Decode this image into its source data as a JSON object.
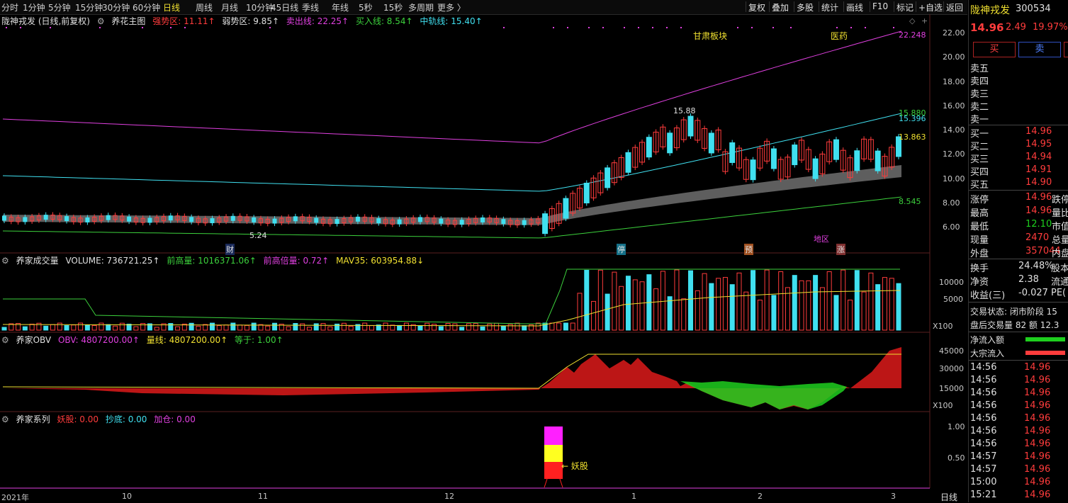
{
  "toolbar": {
    "timeframes": [
      "分时",
      "1分钟",
      "5分钟",
      "15分钟",
      "30分钟",
      "60分钟",
      "日线",
      "周线",
      "月线",
      "10分钟",
      "45日线",
      "季线",
      "年线",
      "5秒",
      "15秒",
      "多周期",
      "更多 〉"
    ],
    "active_timeframe": "日线",
    "right_buttons": [
      "复权",
      "叠加",
      "多股",
      "统计",
      "画线",
      "F10",
      "标记",
      "+自选",
      "返回"
    ]
  },
  "main_legend": {
    "title": "陇神戎发 (日线,前复权)",
    "indicator": "养花主图",
    "items": [
      {
        "label": "强势区: 11.11↑",
        "color": "#ff3c3c"
      },
      {
        "label": "弱势区: 9.85↑",
        "color": "#e0e0e0"
      },
      {
        "label": "卖出线: 22.25↑",
        "color": "#e040e0"
      },
      {
        "label": "买入线: 8.54↑",
        "color": "#3cd13c"
      },
      {
        "label": "中轨线: 15.40↑",
        "color": "#40e0f0"
      }
    ]
  },
  "main_y_ticks": [
    "22.00",
    "20.00",
    "18.00",
    "16.00",
    "14.00",
    "12.00",
    "10.00",
    "8.00",
    "6.00"
  ],
  "main_annotations": {
    "sector_1": "甘肃板块",
    "sector_2": "医药",
    "high_price": "15.88",
    "low_price": "5.24",
    "sell_line_end": "22.248",
    "mid_line_end_a": "15.880",
    "mid_line_end_b": "15.396",
    "strong_end": "13.863",
    "buy_line_end": "8.545",
    "marker_cai": "财",
    "marker_ting": "停",
    "marker_yu": "预",
    "marker_diqu": "地区",
    "marker_zhang": "涨"
  },
  "volume_legend": {
    "title": "养家成交量",
    "items": [
      {
        "label": "VOLUME: 736721.25↑",
        "color": "#e0e0e0"
      },
      {
        "label": "前高量: 1016371.06↑",
        "color": "#3cd13c"
      },
      {
        "label": "前高倍量: 0.72↑",
        "color": "#e040e0"
      },
      {
        "label": "MAV35: 603954.88↓",
        "color": "#f0e030"
      }
    ],
    "y_ticks": [
      "10000",
      "5000"
    ],
    "unit": "X100"
  },
  "obv_legend": {
    "title": "养家OBV",
    "items": [
      {
        "label": "OBV: 4807200.00↑",
        "color": "#e040e0"
      },
      {
        "label": "量线: 4807200.00↑",
        "color": "#f0e030"
      },
      {
        "label": "等于: 1.00↑",
        "color": "#3cd13c"
      }
    ],
    "y_ticks": [
      "45000",
      "30000",
      "15000"
    ],
    "unit": "X100"
  },
  "series_legend": {
    "title": "养家系列",
    "items": [
      {
        "label": "妖股: 0.00",
        "color": "#ff3c3c"
      },
      {
        "label": "抄底: 0.00",
        "color": "#40e0f0"
      },
      {
        "label": "加仓: 0.00",
        "color": "#e040e0"
      }
    ],
    "y_ticks": [
      "1.00",
      "0.50"
    ],
    "marker": "妖股"
  },
  "x_ticks": [
    "2021年",
    "10",
    "11",
    "12",
    "1",
    "2",
    "3"
  ],
  "period_label": "日线",
  "quote": {
    "name": "陇神戎发",
    "code": "300534",
    "price": "14.96",
    "change": "2.49",
    "change_pct": "19.97%",
    "buy_label": "买",
    "sell_label": "卖",
    "asks": [
      {
        "label": "卖五",
        "price": "",
        "vol": ""
      },
      {
        "label": "卖四",
        "price": "",
        "vol": ""
      },
      {
        "label": "卖三",
        "price": "",
        "vol": ""
      },
      {
        "label": "卖二",
        "price": "",
        "vol": ""
      },
      {
        "label": "卖一",
        "price": "",
        "vol": ""
      }
    ],
    "bids": [
      {
        "label": "买一",
        "price": "14.96"
      },
      {
        "label": "买二",
        "price": "14.95"
      },
      {
        "label": "买三",
        "price": "14.94"
      },
      {
        "label": "买四",
        "price": "14.91"
      },
      {
        "label": "买五",
        "price": "14.90"
      }
    ],
    "stats": [
      {
        "label": "涨停",
        "value": "14.96",
        "extra": "跌停"
      },
      {
        "label": "最高",
        "value": "14.96",
        "extra": "量比"
      },
      {
        "label": "最低",
        "value": "12.10",
        "extra": "市值"
      },
      {
        "label": "现量",
        "value": "2470",
        "extra": "总量"
      },
      {
        "label": "外盘",
        "value": "357044",
        "extra": "内盘"
      }
    ],
    "stats2": [
      {
        "label": "换手",
        "value": "24.48%",
        "extra": "股本"
      },
      {
        "label": "净资",
        "value": "2.38",
        "extra": "流通"
      },
      {
        "label": "收益(三)",
        "value": "-0.027",
        "extra": "PE("
      }
    ],
    "trade_status": "交易状态: 闭市阶段 15",
    "after_hours": "盘后交易量 82 额 12.3",
    "net_inflow": "净流入额",
    "big_inflow": "大宗流入",
    "ticks": [
      {
        "time": "14:56",
        "price": "14.96"
      },
      {
        "time": "14:56",
        "price": "14.96"
      },
      {
        "time": "14:56",
        "price": "14.96"
      },
      {
        "time": "14:56",
        "price": "14.96"
      },
      {
        "time": "14:56",
        "price": "14.96"
      },
      {
        "time": "14:56",
        "price": "14.96"
      },
      {
        "time": "14:56",
        "price": "14.96"
      },
      {
        "time": "14:57",
        "price": "14.96"
      },
      {
        "time": "14:57",
        "price": "14.96"
      },
      {
        "time": "15:00",
        "price": "14.96"
      },
      {
        "time": "15:21",
        "price": "14.96"
      }
    ]
  },
  "colors": {
    "up": "#ff3c3c",
    "down": "#40e0f0",
    "sell_line": "#e040e0",
    "mid_line": "#40e0f0",
    "buy_line": "#3cd13c",
    "band": "#6e6e6e",
    "volume_line": "#f0e030"
  }
}
